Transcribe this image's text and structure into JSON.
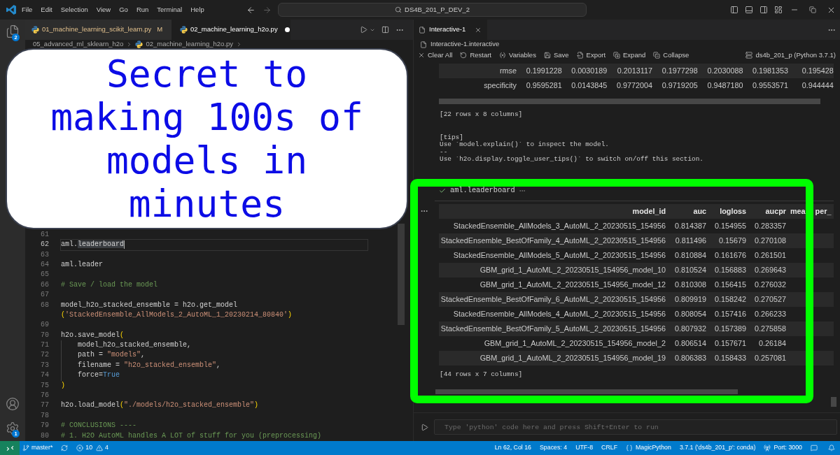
{
  "title_bar": {
    "menu": [
      "File",
      "Edit",
      "Selection",
      "View",
      "Go",
      "Run",
      "Terminal",
      "Help"
    ],
    "command_center": "DS4B_201_P_DEV_2"
  },
  "activity_bar": {
    "explorer_badge": "2",
    "manage_badge": "1"
  },
  "editor": {
    "tabs": [
      {
        "label": "01_machine_learning_scikit_learn.py",
        "decoration": "M",
        "selected": false,
        "unsaved": false
      },
      {
        "label": "02_machine_learning_h2o.py",
        "selected": true,
        "unsaved": true
      }
    ],
    "breadcrumbs": [
      {
        "kind": "folder",
        "label": "05_advanced_ml_sklearn_h2o"
      },
      {
        "kind": "file",
        "label": "02_machine_learning_h2o.py"
      }
    ],
    "lines": [
      {
        "number": "61",
        "current": false
      },
      {
        "number": "62",
        "current": true,
        "tokens": [
          {
            "kind": "plain",
            "text": "aml."
          },
          {
            "kind": "selected",
            "text": "leaderboard"
          }
        ]
      },
      {
        "number": "63",
        "current": false
      },
      {
        "number": "64",
        "current": false,
        "tokens": [
          {
            "kind": "plain",
            "text": "aml.leader"
          }
        ]
      },
      {
        "number": "65",
        "current": false
      },
      {
        "number": "66",
        "current": false,
        "tokens": [
          {
            "kind": "comment",
            "text": "# Save / load the model"
          }
        ]
      },
      {
        "number": "67",
        "current": false
      },
      {
        "number": "68",
        "current": false,
        "tokens": [
          {
            "kind": "plain",
            "text": "model_h2o_stacked_ensemble = h2o.get_model"
          }
        ],
        "continuation": [
          {
            "kind": "bracket",
            "text": "("
          },
          {
            "kind": "string",
            "text": "'StackedEnsemble_AllModels_2_AutoML_1_20230214_80840'"
          },
          {
            "kind": "bracket",
            "text": ")"
          }
        ]
      },
      {
        "number": "69",
        "current": false
      },
      {
        "number": "70",
        "current": false,
        "tokens": [
          {
            "kind": "plain",
            "text": "h2o.save_model"
          },
          {
            "kind": "bracket",
            "text": "("
          }
        ],
        "children": [
          {
            "number": "71",
            "current": false,
            "tokens": [
              {
                "kind": "plain",
                "text": "model_h2o_stacked_ensemble,"
              }
            ]
          },
          {
            "number": "72",
            "current": false,
            "tokens": [
              {
                "kind": "plain",
                "text": "path = "
              },
              {
                "kind": "string",
                "text": "\"models\""
              },
              {
                "kind": "plain",
                "text": ","
              }
            ]
          },
          {
            "number": "73",
            "current": false,
            "tokens": [
              {
                "kind": "plain",
                "text": "filename = "
              },
              {
                "kind": "string",
                "text": "\"h2o_stacked_ensemble\""
              },
              {
                "kind": "plain",
                "text": ","
              }
            ]
          },
          {
            "number": "74",
            "current": false,
            "tokens": [
              {
                "kind": "plain",
                "text": "force="
              },
              {
                "kind": "keyword",
                "text": "True"
              }
            ]
          }
        ]
      },
      {
        "number": "75",
        "current": false,
        "tokens": [
          {
            "kind": "bracket",
            "text": ")"
          }
        ]
      },
      {
        "number": "76",
        "current": false
      },
      {
        "number": "77",
        "current": false,
        "tokens": [
          {
            "kind": "plain",
            "text": "h2o.load_model"
          },
          {
            "kind": "bracket",
            "text": "("
          },
          {
            "kind": "string",
            "text": "\"./models/h2o_stacked_ensemble\""
          },
          {
            "kind": "bracket",
            "text": ")"
          }
        ]
      },
      {
        "number": "78",
        "current": false
      },
      {
        "number": "79",
        "current": false,
        "tokens": [
          {
            "kind": "comment",
            "text": "# CONCLUSIONS ----"
          }
        ]
      },
      {
        "number": "80",
        "current": false,
        "tokens": [
          {
            "kind": "comment",
            "text": "# 1. H2O AutoML handles A LOT of stuff for you (preprocessing)"
          }
        ]
      }
    ]
  },
  "callout": {
    "lines": [
      "Secret to",
      "making 100s of",
      "models in",
      "minutes"
    ]
  },
  "interactive": {
    "tabs": [
      {
        "label": "Interactive-1",
        "selected": true
      }
    ],
    "file": "Interactive-1.interactive",
    "toolbar": [
      "Clear All",
      "Restart",
      "Variables",
      "Save",
      "Export",
      "Expand",
      "Collapse"
    ],
    "kernel": "ds4b_201_p (Python 3.7.1)",
    "earlier_output": {
      "rows": [
        {
          "label": "rmse",
          "values": [
            "0.1991228",
            "0.0030189",
            "0.2013117",
            "0.1977298",
            "0.2030088",
            "0.1981353",
            "0.195428"
          ]
        },
        {
          "label": "specificity",
          "values": [
            "0.9595281",
            "0.0143845",
            "0.9772004",
            "0.9719205",
            "0.9487180",
            "0.9553571",
            "0.944444"
          ]
        }
      ],
      "summary": "[22 rows x 8 columns]",
      "tips": [
        "[tips]",
        "Use `model.explain()` to inspect the model.",
        "--",
        "Use `h2o.display.toggle_user_tips()` to switch on/off this section."
      ]
    },
    "cell": {
      "code": "aml.leaderboard",
      "succeeded": true,
      "leaderboard": {
        "columns": [
          "model_id",
          "auc",
          "logloss",
          "aucpr",
          "mea per_"
        ],
        "rows": [
          [
            "StackedEnsemble_AllModels_3_AutoML_2_20230515_154956",
            "0.814387",
            "0.154955",
            "0.283357"
          ],
          [
            "StackedEnsemble_BestOfFamily_4_AutoML_2_20230515_154956",
            "0.811496",
            "0.15679",
            "0.270108"
          ],
          [
            "StackedEnsemble_AllModels_5_AutoML_2_20230515_154956",
            "0.810884",
            "0.161676",
            "0.261501"
          ],
          [
            "GBM_grid_1_AutoML_2_20230515_154956_model_10",
            "0.810524",
            "0.156883",
            "0.269643"
          ],
          [
            "GBM_grid_1_AutoML_2_20230515_154956_model_12",
            "0.810308",
            "0.156415",
            "0.276032"
          ],
          [
            "StackedEnsemble_BestOfFamily_6_AutoML_2_20230515_154956",
            "0.809919",
            "0.158242",
            "0.270527"
          ],
          [
            "StackedEnsemble_AllModels_4_AutoML_2_20230515_154956",
            "0.808054",
            "0.157416",
            "0.266233"
          ],
          [
            "StackedEnsemble_BestOfFamily_5_AutoML_2_20230515_154956",
            "0.807932",
            "0.157389",
            "0.275858"
          ],
          [
            "GBM_grid_1_AutoML_2_20230515_154956_model_2",
            "0.806514",
            "0.157671",
            "0.26184"
          ],
          [
            "GBM_grid_1_AutoML_2_20230515_154956_model_19",
            "0.806383",
            "0.158433",
            "0.257081"
          ]
        ]
      },
      "summary": "[44 rows x 7 columns]"
    },
    "input": {
      "placeholder": "Type 'python' code here and press Shift+Enter to run"
    }
  },
  "status_bar": {
    "branch": "master*",
    "errors": "10",
    "warnings": "4",
    "items": [
      {
        "kind": "text",
        "label": "Ln 62, Col 16"
      },
      {
        "kind": "text",
        "label": "Spaces: 4"
      },
      {
        "kind": "text",
        "label": "UTF-8"
      },
      {
        "kind": "text",
        "label": "CRLF"
      },
      {
        "kind": "language",
        "label": "MagicPython"
      },
      {
        "kind": "text",
        "label": "3.7.1 ('ds4b_201_p': conda)"
      },
      {
        "kind": "port",
        "label": "Port: 3000"
      }
    ]
  }
}
